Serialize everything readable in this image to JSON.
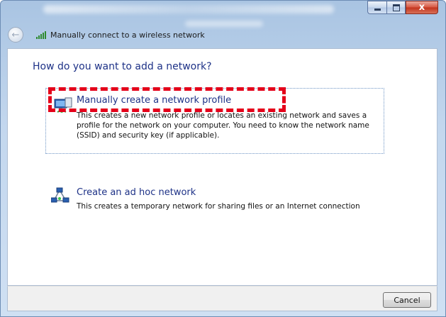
{
  "window": {
    "title": "Manually connect to a wireless network",
    "caption_buttons": {
      "minimize": "–",
      "maximize": "□",
      "close": "x"
    }
  },
  "page": {
    "heading": "How do you want to add a network?"
  },
  "options": [
    {
      "title": "Manually create a network profile",
      "description": "This creates a new network profile or locates an existing network and saves a profile for the network on your computer. You need to know the network name (SSID) and security key (if applicable).",
      "icon": "network-profile-icon"
    },
    {
      "title": "Create an ad hoc network",
      "description": "This creates a temporary network for sharing files or an Internet connection",
      "icon": "ad-hoc-network-icon"
    }
  ],
  "footer": {
    "cancel_label": "Cancel"
  },
  "colors": {
    "heading": "#1e3287",
    "highlight": "#e4001a",
    "close_button": "#c2341d"
  }
}
